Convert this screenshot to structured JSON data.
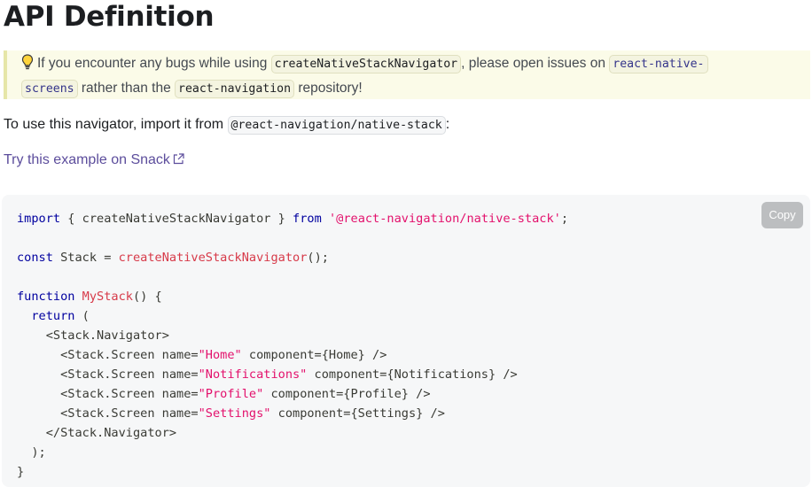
{
  "page_title": "API Definition",
  "tip": {
    "icon": "lightbulb-icon",
    "line1_prefix": "If you encounter any bugs while using ",
    "line1_code": "createNativeStackNavigator",
    "line1_mid": ", please open issues on ",
    "line1_code2": "react-native-",
    "line2_code": "screens",
    "line2_mid": " rather than the ",
    "line2_code2": "react-navigation",
    "line2_suffix": " repository!"
  },
  "intro": {
    "prefix": "To use this navigator, import it from ",
    "code": "@react-navigation/native-stack",
    "suffix": ":"
  },
  "snack_link": "Try this example on Snack",
  "copy_button": "Copy",
  "code": {
    "l1_import": "import",
    "l1_mid": " { createNativeStackNavigator } ",
    "l1_from": "from",
    "l1_str": "'@react-navigation/native-stack'",
    "l1_end": ";",
    "l3_const": "const",
    "l3_mid": " Stack = ",
    "l3_fn": "createNativeStackNavigator",
    "l3_end": "();",
    "l5_function": "function",
    "l5_fn": "MyStack",
    "l5_end": "() {",
    "l6_return": "return",
    "l6_end": " (",
    "l7": "<Stack.Navigator>",
    "screens": [
      {
        "pre": "<Stack.Screen name=",
        "name": "\"Home\"",
        "post": " component={Home} />"
      },
      {
        "pre": "<Stack.Screen name=",
        "name": "\"Notifications\"",
        "post": " component={Notifications} />"
      },
      {
        "pre": "<Stack.Screen name=",
        "name": "\"Profile\"",
        "post": " component={Profile} />"
      },
      {
        "pre": "<Stack.Screen name=",
        "name": "\"Settings\"",
        "post": " component={Settings} />"
      }
    ],
    "l12": "</Stack.Navigator>",
    "l13": ");",
    "l14": "}"
  }
}
